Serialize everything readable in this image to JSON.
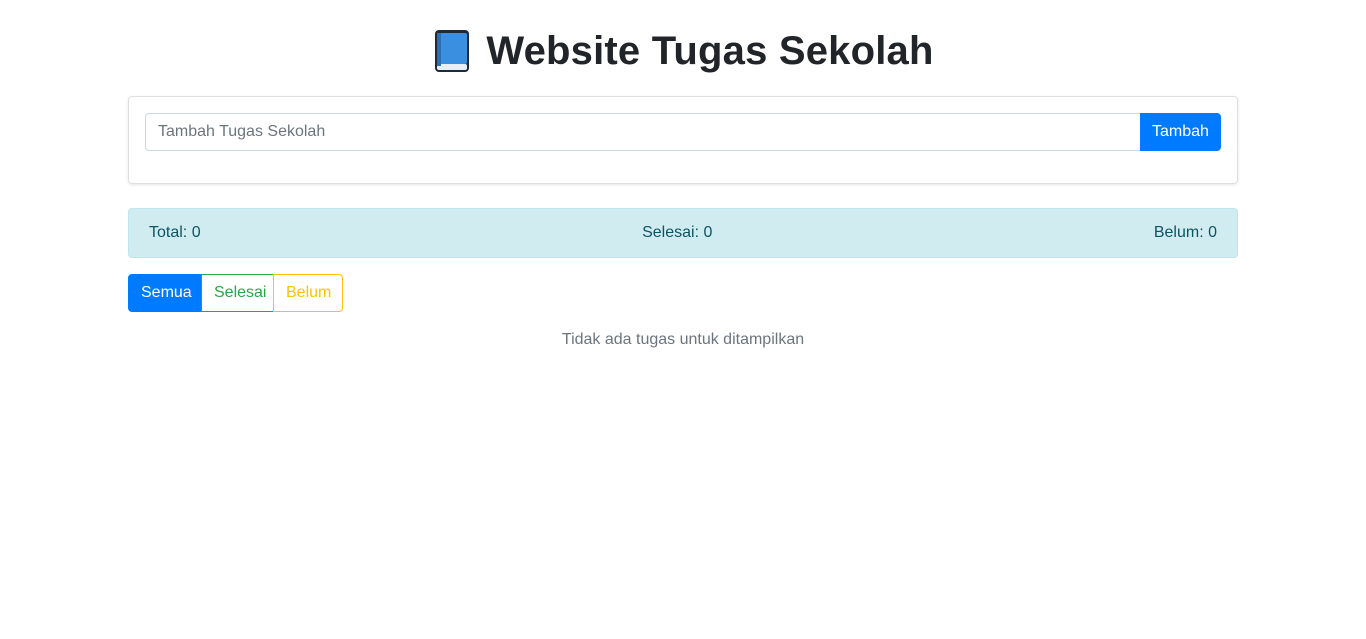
{
  "header": {
    "title": "Website Tugas Sekolah",
    "icon": "blue-book-icon"
  },
  "form": {
    "input_placeholder": "Tambah Tugas Sekolah",
    "input_value": "",
    "add_label": "Tambah"
  },
  "stats": {
    "total": "Total: 0",
    "done": "Selesai: 0",
    "pending": "Belum: 0"
  },
  "filters": {
    "all": "Semua",
    "done": "Selesai",
    "pending": "Belum",
    "active": "Semua"
  },
  "empty_message": "Tidak ada tugas untuk ditampilkan",
  "colors": {
    "primary": "#007bff",
    "success": "#28a745",
    "warning": "#ffc107",
    "info_bg": "#d1ecf1",
    "info_text": "#0c5460"
  }
}
